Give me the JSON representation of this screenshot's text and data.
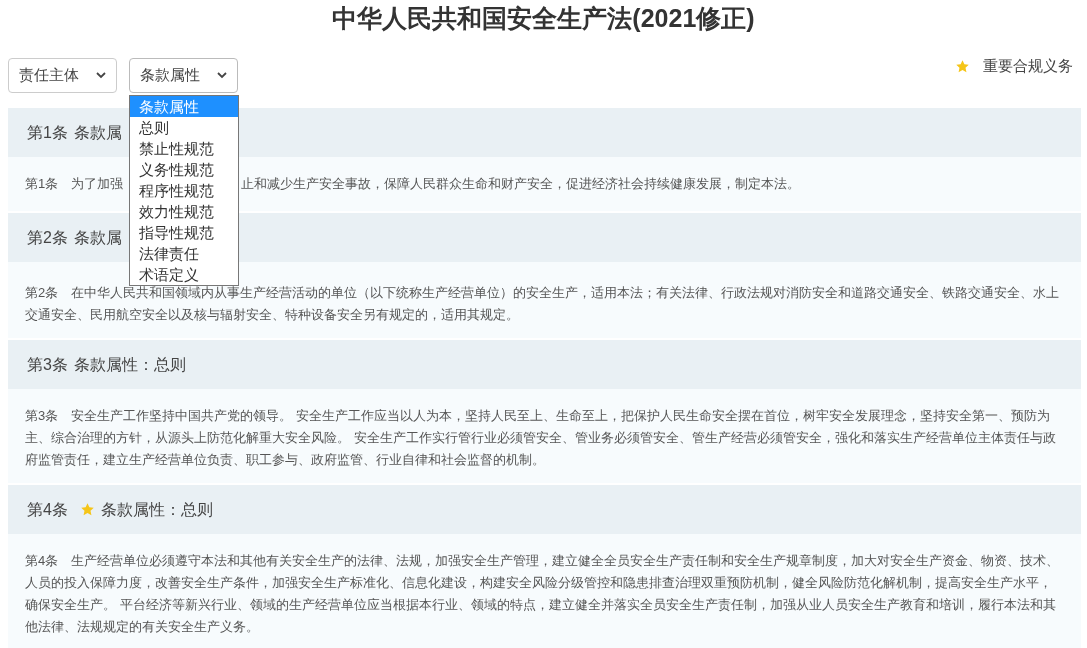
{
  "title": "中华人民共和国安全生产法(2021修正)",
  "filters": [
    {
      "label": "责任主体",
      "open": false
    },
    {
      "label": "条款属性",
      "open": true,
      "options": [
        {
          "label": "条款属性",
          "selected": true
        },
        {
          "label": "总则",
          "selected": false
        },
        {
          "label": "禁止性规范",
          "selected": false
        },
        {
          "label": "义务性规范",
          "selected": false
        },
        {
          "label": "程序性规范",
          "selected": false
        },
        {
          "label": "效力性规范",
          "selected": false
        },
        {
          "label": "指导性规范",
          "selected": false
        },
        {
          "label": "法律责任",
          "selected": false
        },
        {
          "label": "术语定义",
          "selected": false
        }
      ]
    }
  ],
  "legend": {
    "label": "重要合规义务"
  },
  "articles": [
    {
      "number": "第1条",
      "attribute": "条款属",
      "important": false,
      "body": [
        "第1条　为了加强",
        "止和减少生产安全事故，保障人民群众生命和财产安全，促进经济社会持续健康发展，制定本法。"
      ]
    },
    {
      "number": "第2条",
      "attribute": "条款属",
      "important": false,
      "body": [
        "第2条　在中华人民共和国领域内从事生产经营活动的单位（以下统称生产经营单位）的安全生产，适用本法；有关法律、行政法规对消防安全和道路交通安全、铁路交通安全、水上交通安全、民用航空安全以及核与辐射安全、特种设备安全另有规定的，适用其规定。"
      ]
    },
    {
      "number": "第3条",
      "attribute": "条款属性：总则",
      "important": false,
      "body": [
        "第3条　安全生产工作坚持中国共产党的领导。 安全生产工作应当以人为本，坚持人民至上、生命至上，把保护人民生命安全摆在首位，树牢安全发展理念，坚持安全第一、预防为主、综合治理的方针，从源头上防范化解重大安全风险。 安全生产工作实行管行业必须管安全、管业务必须管安全、管生产经营必须管安全，强化和落实生产经营单位主体责任与政府监管责任，建立生产经营单位负责、职工参与、政府监管、行业自律和社会监督的机制。"
      ]
    },
    {
      "number": "第4条",
      "attribute": "条款属性：总则",
      "important": true,
      "body": [
        "第4条　生产经营单位必须遵守本法和其他有关安全生产的法律、法规，加强安全生产管理，建立健全全员安全生产责任制和安全生产规章制度，加大对安全生产资金、物资、技术、人员的投入保障力度，改善安全生产条件，加强安全生产标准化、信息化建设，构建安全风险分级管控和隐患排查治理双重预防机制，健全风险防范化解机制，提高安全生产水平，确保安全生产。 平台经济等新兴行业、领域的生产经营单位应当根据本行业、领域的特点，建立健全并落实全员安全生产责任制，加强从业人员安全生产教育和培训，履行本法和其他法律、法规规定的有关安全生产义务。"
      ]
    }
  ]
}
